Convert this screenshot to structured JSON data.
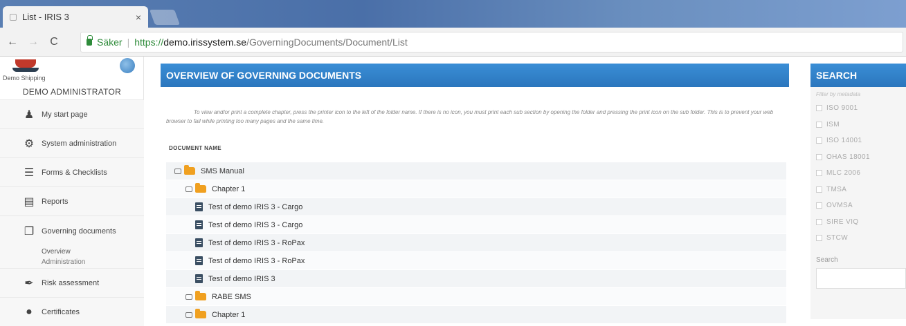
{
  "browser": {
    "tab_title": "List - IRIS 3",
    "tab_close": "×",
    "secure_label": "Säker",
    "url_protocol": "https://",
    "url_host": "demo.irissystem.se",
    "url_path": "/GoverningDocuments/Document/List"
  },
  "sidebar": {
    "logo_text": "Demo Shipping",
    "admin_name": "DEMO ADMINISTRATOR",
    "items": [
      {
        "label": "My start page",
        "icon": "person-icon"
      },
      {
        "label": "System administration",
        "icon": "gear-icon"
      },
      {
        "label": "Forms & Checklists",
        "icon": "list-icon"
      },
      {
        "label": "Reports",
        "icon": "report-icon"
      },
      {
        "label": "Governing documents",
        "icon": "documents-icon"
      },
      {
        "label": "Risk assessment",
        "icon": "pen-icon"
      },
      {
        "label": "Certificates",
        "icon": "certificate-icon"
      }
    ],
    "submenu": {
      "overview": "Overview",
      "administration": "Administration"
    }
  },
  "main": {
    "title": "OVERVIEW OF GOVERNING DOCUMENTS",
    "intro": "To view and/or print a complete chapter, press the printer icon to the left of the folder name. If there is no icon, you must print each sub section by opening the folder and pressing the print icon on the sub folder. This is to prevent your web browser to fail while printing too many pages and the same time.",
    "column_header": "DOCUMENT NAME",
    "tree": [
      {
        "label": "SMS Manual",
        "level": 0,
        "type": "folder"
      },
      {
        "label": "Chapter 1",
        "level": 1,
        "type": "folder"
      },
      {
        "label": "Test of demo IRIS 3 - Cargo",
        "level": 2,
        "type": "doc"
      },
      {
        "label": "Test of demo IRIS 3 - Cargo",
        "level": 2,
        "type": "doc"
      },
      {
        "label": "Test of demo IRIS 3 - RoPax",
        "level": 2,
        "type": "doc"
      },
      {
        "label": "Test of demo IRIS 3 - RoPax",
        "level": 2,
        "type": "doc"
      },
      {
        "label": "Test of demo IRIS 3",
        "level": 2,
        "type": "doc"
      },
      {
        "label": "RABE SMS",
        "level": 1,
        "type": "folder"
      },
      {
        "label": "Chapter 1",
        "level": 1,
        "type": "folder"
      }
    ]
  },
  "search": {
    "title": "SEARCH",
    "filter_hint": "Filter by metadata",
    "filters": [
      "ISO 9001",
      "ISM",
      "ISO 14001",
      "OHAS 18001",
      "MLC 2006",
      "TMSA",
      "OVMSA",
      "SIRE VIQ",
      "STCW"
    ],
    "search_label": "Search"
  },
  "colors": {
    "header_blue": "#2b76bd",
    "folder_orange": "#f0a020",
    "secure_green": "#2e8b3a"
  }
}
